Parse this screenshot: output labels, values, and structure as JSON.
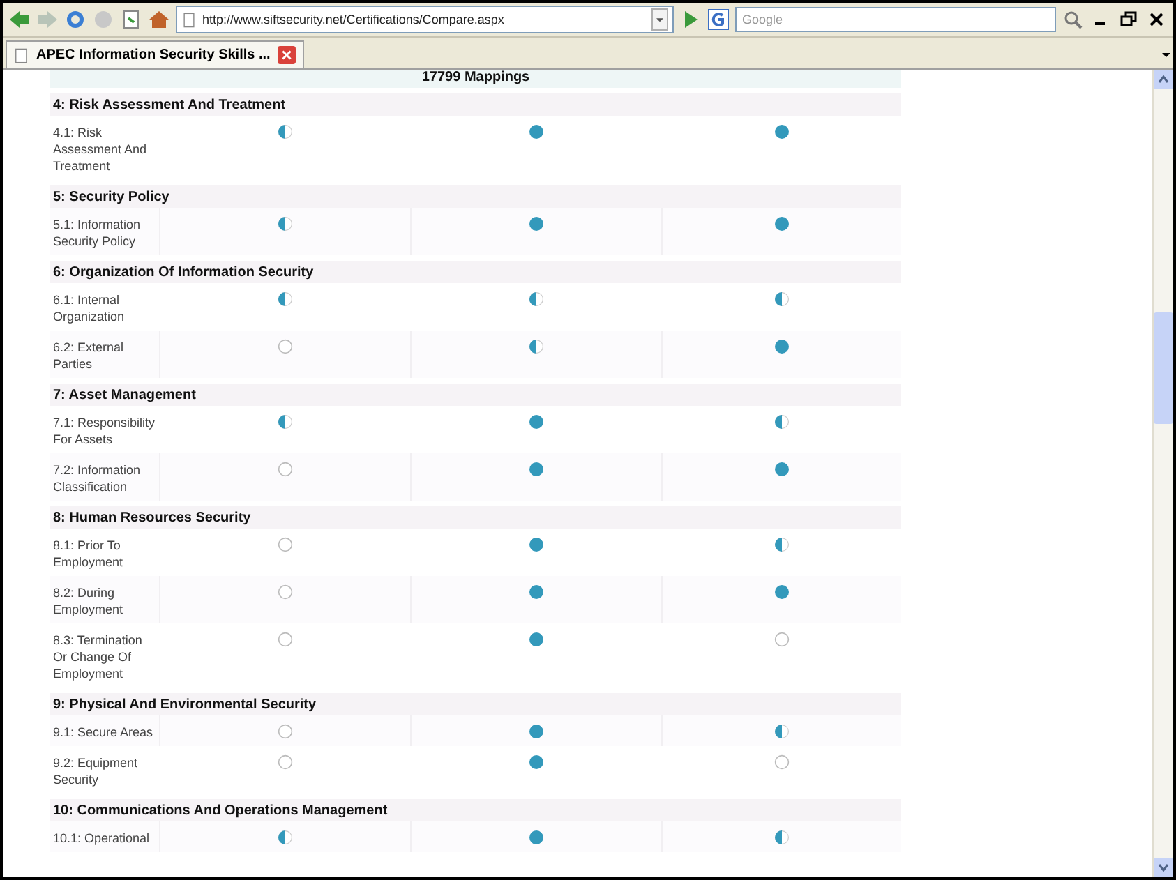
{
  "toolbar": {
    "address": "http://www.siftsecurity.net/Certifications/Compare.aspx",
    "search": {
      "placeholder": "Google"
    }
  },
  "tabs": [
    {
      "label": "APEC Information Security Skills ...",
      "selected": true
    }
  ],
  "table": {
    "caption": "17799 Mappings",
    "sections": [
      {
        "title": "4: Risk Assessment And Treatment",
        "rows": [
          {
            "label": "4.1: Risk Assessment And Treatment",
            "cells": [
              {
                "kind": "partial"
              },
              {
                "kind": "full"
              },
              {
                "kind": "full"
              }
            ]
          }
        ]
      },
      {
        "title": "5: Security Policy",
        "rows": [
          {
            "label": "5.1: Information Security Policy",
            "cells": [
              {
                "kind": "partial"
              },
              {
                "kind": "full"
              },
              {
                "kind": "full"
              }
            ]
          }
        ]
      },
      {
        "title": "6: Organization Of Information Security",
        "rows": [
          {
            "label": "6.1: Internal Organization",
            "cells": [
              {
                "kind": "partial"
              },
              {
                "kind": "partial"
              },
              {
                "kind": "partial"
              }
            ]
          },
          {
            "label": "6.2: External Parties",
            "cells": [
              {
                "kind": "none"
              },
              {
                "kind": "partial"
              },
              {
                "kind": "full"
              }
            ]
          }
        ]
      },
      {
        "title": "7: Asset Management",
        "rows": [
          {
            "label": "7.1: Responsibility For Assets",
            "cells": [
              {
                "kind": "partial"
              },
              {
                "kind": "full"
              },
              {
                "kind": "partial"
              }
            ]
          },
          {
            "label": "7.2: Information Classification",
            "cells": [
              {
                "kind": "none"
              },
              {
                "kind": "full"
              },
              {
                "kind": "full"
              }
            ]
          }
        ]
      },
      {
        "title": "8: Human Resources Security",
        "rows": [
          {
            "label": "8.1: Prior To Employment",
            "cells": [
              {
                "kind": "none"
              },
              {
                "kind": "full"
              },
              {
                "kind": "partial"
              }
            ]
          },
          {
            "label": "8.2: During Employment",
            "cells": [
              {
                "kind": "none"
              },
              {
                "kind": "full"
              },
              {
                "kind": "full"
              }
            ]
          },
          {
            "label": "8.3: Termination Or Change Of Employment",
            "cells": [
              {
                "kind": "none"
              },
              {
                "kind": "full"
              },
              {
                "kind": "none"
              }
            ]
          }
        ]
      },
      {
        "title": "9: Physical And Environmental Security",
        "rows": [
          {
            "label": "9.1: Secure Areas",
            "cells": [
              {
                "kind": "none"
              },
              {
                "kind": "full"
              },
              {
                "kind": "partial"
              }
            ]
          },
          {
            "label": "9.2: Equipment Security",
            "cells": [
              {
                "kind": "none"
              },
              {
                "kind": "full"
              },
              {
                "kind": "none"
              }
            ]
          }
        ]
      },
      {
        "title": "10: Communications And Operations Management",
        "rows": [
          {
            "label": "10.1: Operational",
            "cells": [
              {
                "kind": "partial"
              },
              {
                "kind": "full"
              },
              {
                "kind": "partial"
              }
            ]
          }
        ]
      }
    ]
  }
}
